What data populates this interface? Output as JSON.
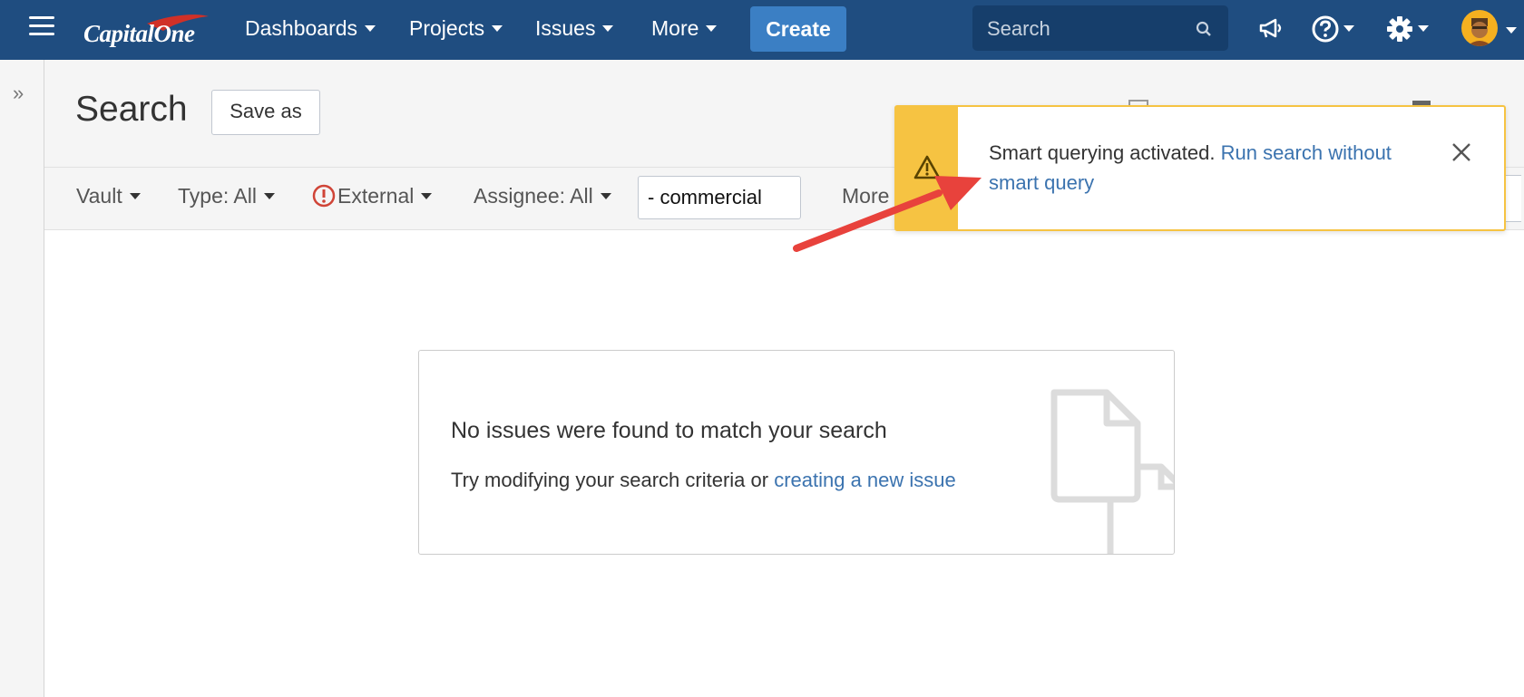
{
  "nav": {
    "brand": "CapitalOne",
    "items": [
      {
        "label": "Dashboards"
      },
      {
        "label": "Projects"
      },
      {
        "label": "Issues"
      },
      {
        "label": "More"
      }
    ],
    "create_label": "Create",
    "search_placeholder": "Search",
    "accent_color": "#1f4d80"
  },
  "page": {
    "title": "Search",
    "save_as_label": "Save as"
  },
  "filters": {
    "vault": "Vault",
    "type": "Type: All",
    "status": "External",
    "assignee": "Assignee: All",
    "text_value": "- commercial",
    "more": "More"
  },
  "notification": {
    "text": "Smart querying activated.",
    "link": "Run search without smart query",
    "color": "#f6c342"
  },
  "empty_state": {
    "heading": "No issues were found to match your search",
    "tip": "Try modifying your search criteria or",
    "link": "creating a new issue"
  }
}
